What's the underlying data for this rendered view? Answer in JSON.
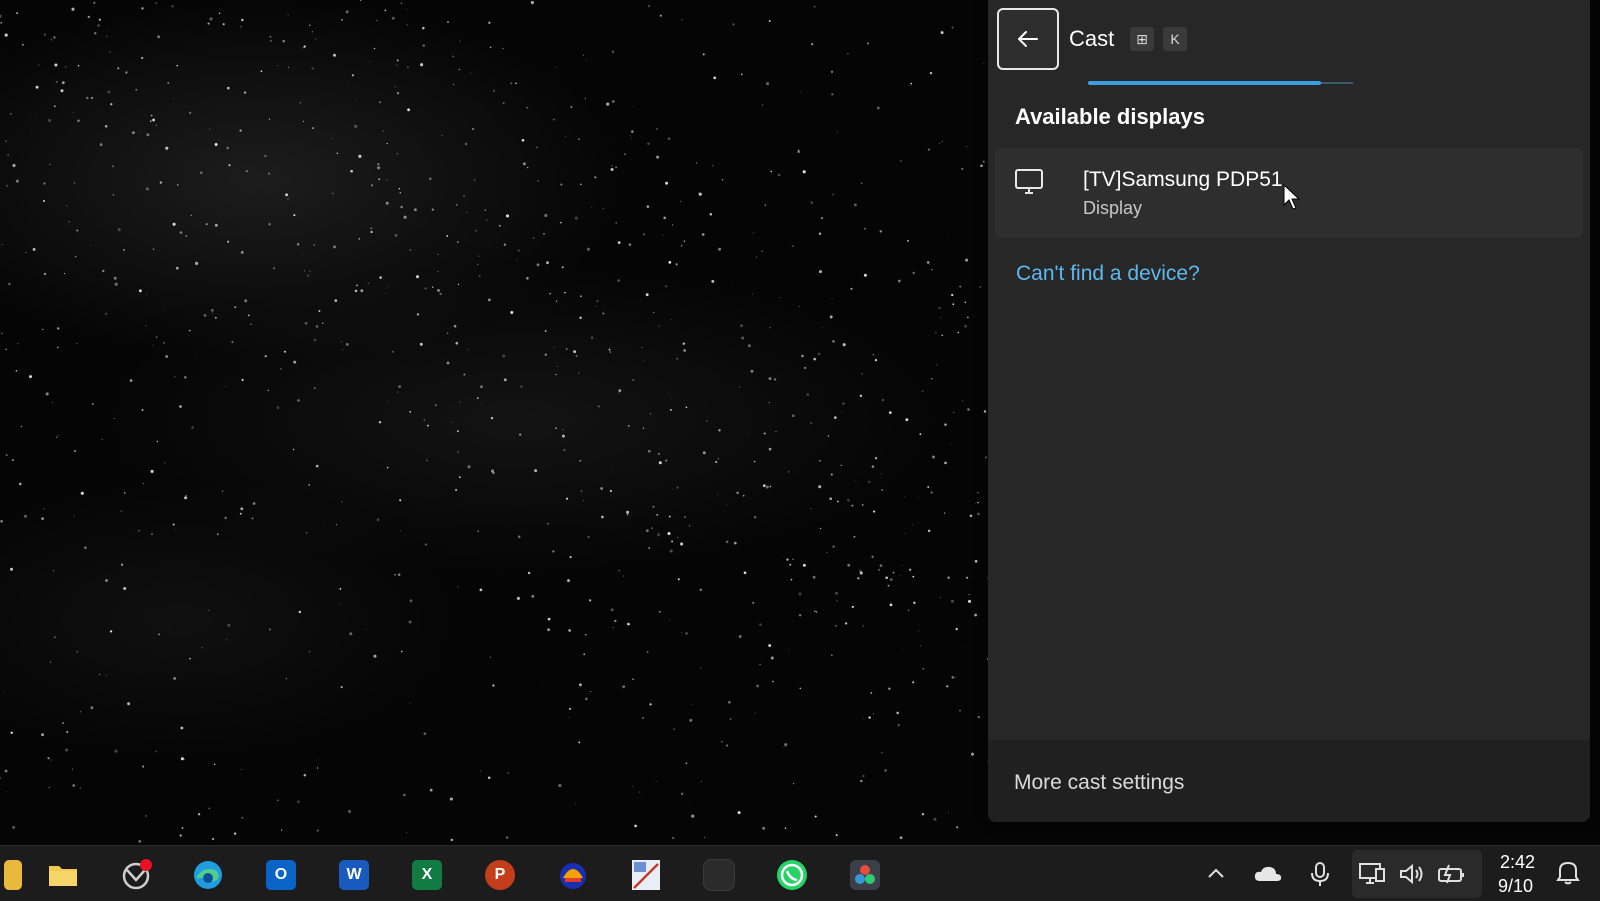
{
  "cast_panel": {
    "title": "Cast",
    "shortcut_keys": [
      "⊞",
      "K"
    ],
    "loading_progress": 0.88,
    "section_heading": "Available displays",
    "devices": [
      {
        "name": "[TV]Samsung PDP51",
        "type": "Display",
        "icon": "monitor-icon"
      }
    ],
    "cant_find_link": "Can't find a device?",
    "more_settings": "More cast settings"
  },
  "taskbar": {
    "apps": [
      {
        "name": "file-explorer",
        "icon": "folder-icon"
      },
      {
        "name": "copilot",
        "icon": "copilot-icon"
      },
      {
        "name": "edge",
        "icon": "edge-icon"
      },
      {
        "name": "outlook",
        "icon": "outlook-icon",
        "letter": "O",
        "color": "#0a64c8"
      },
      {
        "name": "word",
        "icon": "word-icon",
        "letter": "W",
        "color": "#185abd"
      },
      {
        "name": "excel",
        "icon": "excel-icon",
        "letter": "X",
        "color": "#107c41"
      },
      {
        "name": "powerpoint",
        "icon": "powerpoint-icon",
        "letter": "P",
        "color": "#c43e1c"
      },
      {
        "name": "app-8",
        "icon": "app-icon"
      },
      {
        "name": "snipping",
        "icon": "snipping-icon"
      },
      {
        "name": "app-10",
        "icon": "app-icon"
      },
      {
        "name": "whatsapp",
        "icon": "whatsapp-icon"
      },
      {
        "name": "davinci",
        "icon": "davinci-icon"
      }
    ],
    "tray": [
      "chevron-up-icon",
      "onedrive-icon",
      "microphone-icon",
      "display-icon",
      "volume-icon",
      "battery-icon"
    ],
    "clock": {
      "time": "2:42",
      "date": "9/10"
    },
    "colors": {
      "accent": "#3aa0e0",
      "link": "#5fb8ee"
    }
  }
}
